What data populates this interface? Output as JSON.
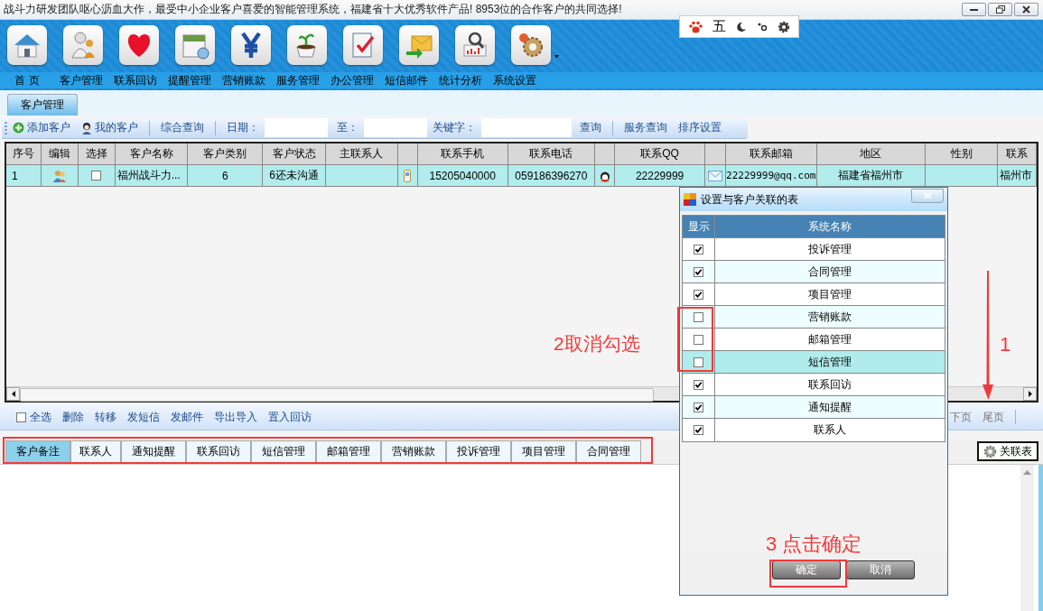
{
  "window": {
    "title": "战斗力研发团队呕心沥血大作，最受中小企业客户喜爱的智能管理系统，福建省十大优秀软件产品! 8953位的合作客户的共同选择!"
  },
  "ime_bar": {
    "mode": "五"
  },
  "toolbar": {
    "items": [
      {
        "label": "首 页"
      },
      {
        "label": "客户管理"
      },
      {
        "label": "联系回访"
      },
      {
        "label": "提醒管理"
      },
      {
        "label": "营销账款"
      },
      {
        "label": "服务管理"
      },
      {
        "label": "办公管理"
      },
      {
        "label": "短信邮件"
      },
      {
        "label": "统计分析"
      },
      {
        "label": "系统设置"
      }
    ]
  },
  "module_tabs": [
    {
      "label": "客户管理",
      "selected": true
    }
  ],
  "action_bar": {
    "add_customer": "添加客户",
    "my_customers": "我的客户",
    "combined_query": "综合查询",
    "date_label": "日期：",
    "to_label": "至：",
    "keyword_label": "关键字：",
    "query": "查询",
    "service_query": "服务查询",
    "sort_settings": "排序设置"
  },
  "table": {
    "columns": [
      {
        "kind": "text",
        "label": "序号"
      },
      {
        "kind": "text",
        "label": "编辑"
      },
      {
        "kind": "text",
        "label": "选择"
      },
      {
        "kind": "text",
        "label": "客户名称"
      },
      {
        "kind": "text",
        "label": "客户类别"
      },
      {
        "kind": "text",
        "label": "客户状态"
      },
      {
        "kind": "text",
        "label": "主联系人"
      },
      {
        "kind": "blank"
      },
      {
        "kind": "text",
        "label": "联系手机"
      },
      {
        "kind": "text",
        "label": "联系电话"
      },
      {
        "kind": "blank"
      },
      {
        "kind": "text",
        "label": "联系QQ"
      },
      {
        "kind": "blank"
      },
      {
        "kind": "text",
        "label": "联系邮箱"
      },
      {
        "kind": "text",
        "label": "地区"
      },
      {
        "kind": "text",
        "label": "性别"
      },
      {
        "kind": "text",
        "label": "联系"
      }
    ],
    "rows": [
      {
        "selected": true,
        "cells": [
          {
            "kind": "text",
            "text": "1"
          },
          {
            "kind": "edit"
          },
          {
            "kind": "checkbox",
            "checked": false
          },
          {
            "kind": "text",
            "text": "福州战斗力..."
          },
          {
            "kind": "text",
            "text": "6"
          },
          {
            "kind": "text",
            "text": "6还未沟通"
          },
          {
            "kind": "empty"
          },
          {
            "kind": "phone"
          },
          {
            "kind": "text",
            "text": "15205040000"
          },
          {
            "kind": "text",
            "text": "059186396270"
          },
          {
            "kind": "qq"
          },
          {
            "kind": "text",
            "text": "22229999"
          },
          {
            "kind": "mail"
          },
          {
            "kind": "text",
            "text": "22229999@qq.com"
          },
          {
            "kind": "text",
            "text": "福建省福州市"
          },
          {
            "kind": "empty"
          },
          {
            "kind": "text",
            "text": "福州市"
          }
        ]
      }
    ]
  },
  "bottom_bar": {
    "select_all": {
      "label": "全选",
      "checked": false
    },
    "actions": [
      "删除",
      "转移",
      "发短信",
      "发邮件",
      "导出导入",
      "置入回访"
    ],
    "pager": [
      "下页",
      "尾页"
    ]
  },
  "detail_tabs": [
    {
      "label": "客户备注",
      "selected": true
    },
    {
      "label": "联系人",
      "selected": false
    },
    {
      "label": "通知提醒",
      "selected": false
    },
    {
      "label": "联系回访",
      "selected": false
    },
    {
      "label": "短信管理",
      "selected": false
    },
    {
      "label": "邮箱管理",
      "selected": false
    },
    {
      "label": "营销账款",
      "selected": false
    },
    {
      "label": "投诉管理",
      "selected": false
    },
    {
      "label": "项目管理",
      "selected": false
    },
    {
      "label": "合同管理",
      "selected": false
    }
  ],
  "link_table_button": "关联表",
  "dialog": {
    "title": "设置与客户关联的表",
    "columns": [
      "显示",
      "系统名称"
    ],
    "rows": [
      {
        "name": "投诉管理",
        "checked": true,
        "selected": false
      },
      {
        "name": "合同管理",
        "checked": true,
        "selected": false
      },
      {
        "name": "项目管理",
        "checked": true,
        "selected": false
      },
      {
        "name": "营销账款",
        "checked": false,
        "selected": false
      },
      {
        "name": "邮箱管理",
        "checked": false,
        "selected": false
      },
      {
        "name": "短信管理",
        "checked": false,
        "selected": true
      },
      {
        "name": "联系回访",
        "checked": true,
        "selected": false
      },
      {
        "name": "通知提醒",
        "checked": true,
        "selected": false
      },
      {
        "name": "联系人",
        "checked": true,
        "selected": false
      }
    ],
    "buttons": [
      "确定",
      "取消"
    ]
  },
  "annotations": {
    "step1": "1",
    "step2": "2取消勾选",
    "step3": "3 点击确定"
  }
}
